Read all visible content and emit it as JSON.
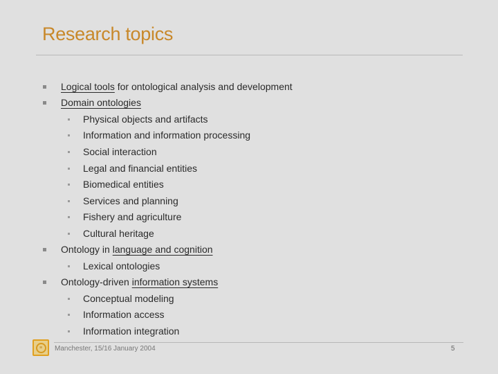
{
  "slide": {
    "title": "Research topics",
    "bullets": [
      {
        "parts": [
          {
            "text": "Logical tools",
            "underline": true
          },
          {
            "text": " for ontological analysis and development",
            "underline": false
          }
        ]
      },
      {
        "parts": [
          {
            "text": "Domain ontologies",
            "underline": true
          }
        ],
        "children": [
          "Physical objects and artifacts",
          "Information and information processing",
          "Social interaction",
          "Legal and financial entities",
          "Biomedical entities",
          "Services and planning",
          "Fishery and agriculture",
          "Cultural heritage"
        ]
      },
      {
        "parts": [
          {
            "text": "Ontology in ",
            "underline": false
          },
          {
            "text": "language and cognition",
            "underline": true
          }
        ],
        "children": [
          "Lexical ontologies"
        ]
      },
      {
        "parts": [
          {
            "text": "Ontology-driven ",
            "underline": false
          },
          {
            "text": "information systems",
            "underline": true
          }
        ],
        "children": [
          "Conceptual modeling",
          "Information access",
          "Information integration"
        ]
      }
    ]
  },
  "footer": {
    "logo_icon": "institution-logo-icon",
    "text": "Manchester, 15/16 January 2004",
    "page_number": "5"
  },
  "colors": {
    "background": "#e0e0e0",
    "title": "#c8882a",
    "text": "#2a2a2a"
  }
}
